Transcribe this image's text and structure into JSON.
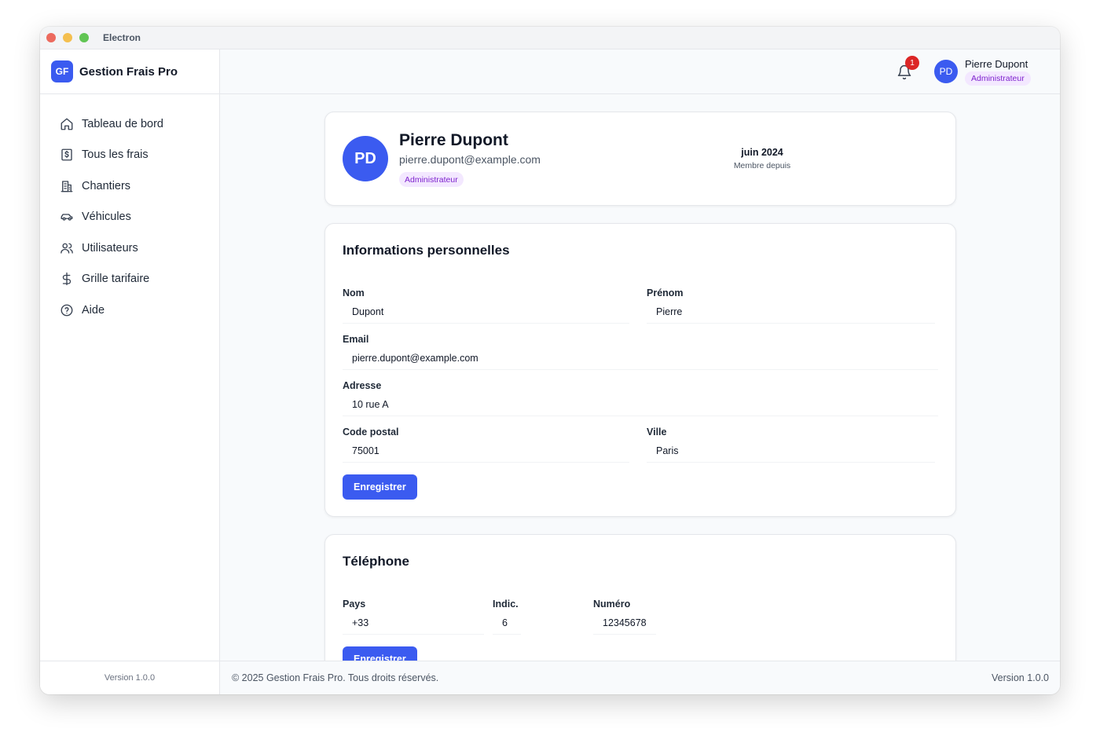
{
  "window": {
    "title": "Electron"
  },
  "brand": {
    "logo": "GF",
    "name": "Gestion Frais Pro"
  },
  "sidebar": {
    "items": [
      {
        "label": "Tableau de bord",
        "icon": "home-icon"
      },
      {
        "label": "Tous les frais",
        "icon": "receipt-icon"
      },
      {
        "label": "Chantiers",
        "icon": "building-icon"
      },
      {
        "label": "Véhicules",
        "icon": "car-icon"
      },
      {
        "label": "Utilisateurs",
        "icon": "users-icon"
      },
      {
        "label": "Grille tarifaire",
        "icon": "dollar-icon"
      },
      {
        "label": "Aide",
        "icon": "help-circle-icon"
      }
    ],
    "version": "Version 1.0.0"
  },
  "header": {
    "notifications_count": "1",
    "user_initials": "PD",
    "user_name": "Pierre Dupont",
    "user_role": "Administrateur"
  },
  "profile": {
    "initials": "PD",
    "name": "Pierre Dupont",
    "email": "pierre.dupont@example.com",
    "role": "Administrateur",
    "member_since_value": "juin 2024",
    "member_since_label": "Membre depuis"
  },
  "personal_info": {
    "title": "Informations personnelles",
    "nom_label": "Nom",
    "nom_value": "Dupont",
    "prenom_label": "Prénom",
    "prenom_value": "Pierre",
    "email_label": "Email",
    "email_value": "pierre.dupont@example.com",
    "adresse_label": "Adresse",
    "adresse_value": "10 rue A",
    "code_postal_label": "Code postal",
    "code_postal_value": "75001",
    "ville_label": "Ville",
    "ville_value": "Paris",
    "save_label": "Enregistrer"
  },
  "phone": {
    "title": "Téléphone",
    "pays_label": "Pays",
    "pays_value": "+33",
    "indic_label": "Indic.",
    "indic_value": "6",
    "numero_label": "Numéro",
    "numero_value": "12345678",
    "save_label": "Enregistrer"
  },
  "footer": {
    "copyright": "© 2025 Gestion Frais Pro. Tous droits réservés.",
    "version": "Version 1.0.0"
  },
  "colors": {
    "accent": "#3b5bf0",
    "badge_bg": "#f3e8ff",
    "badge_text": "#7e22ce",
    "notification": "#dc2626"
  }
}
